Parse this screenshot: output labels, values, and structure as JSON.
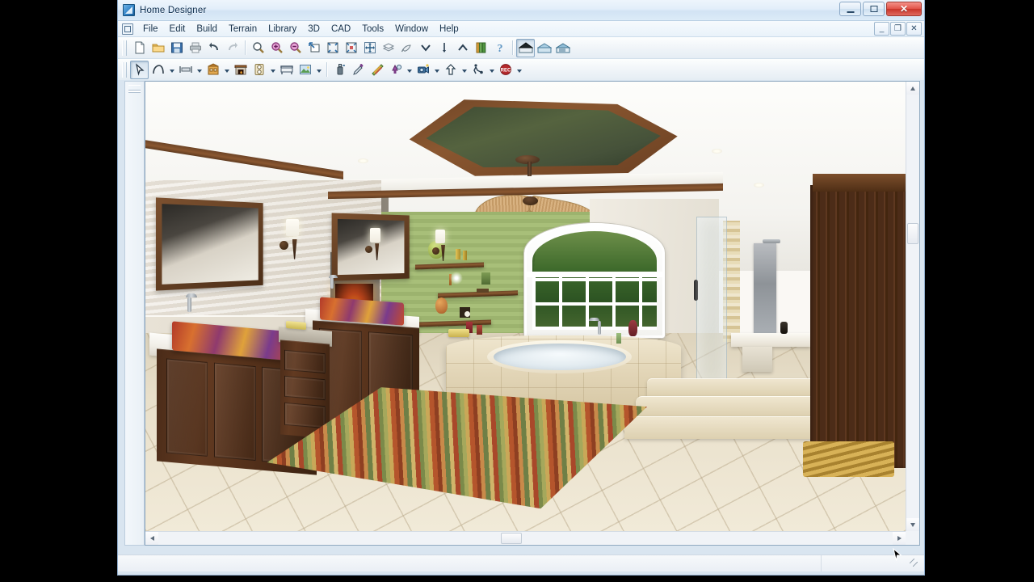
{
  "window": {
    "title": "Home Designer",
    "app_icon": "home-designer-logo-icon",
    "controls": {
      "minimize": "minimize-icon",
      "maximize": "maximize-icon",
      "close": "close-icon",
      "close_glyph": "✕"
    }
  },
  "mdi": {
    "icon": "document-window-icon",
    "controls": {
      "minimize": "_",
      "restore": "❐",
      "close": "✕"
    }
  },
  "menu": {
    "items": [
      {
        "label": "File"
      },
      {
        "label": "Edit"
      },
      {
        "label": "Build"
      },
      {
        "label": "Terrain"
      },
      {
        "label": "Library"
      },
      {
        "label": "3D"
      },
      {
        "label": "CAD"
      },
      {
        "label": "Tools"
      },
      {
        "label": "Window"
      },
      {
        "label": "Help"
      }
    ]
  },
  "toolbar_main": {
    "buttons": [
      {
        "name": "new-plan-button",
        "icon": "new-document-icon"
      },
      {
        "name": "open-plan-button",
        "icon": "open-folder-icon"
      },
      {
        "name": "save-plan-button",
        "icon": "floppy-save-icon"
      },
      {
        "name": "print-button",
        "icon": "printer-icon"
      },
      {
        "name": "undo-button",
        "icon": "undo-arrow-icon"
      },
      {
        "name": "redo-button",
        "icon": "redo-arrow-icon"
      },
      {
        "name": "zoom-button",
        "icon": "magnifier-icon"
      },
      {
        "name": "zoom-in-button",
        "icon": "magnifier-plus-icon"
      },
      {
        "name": "zoom-out-button",
        "icon": "magnifier-minus-icon"
      },
      {
        "name": "zoom-previous-button",
        "icon": "zoom-previous-icon"
      },
      {
        "name": "fill-window-button",
        "icon": "fill-window-icon"
      },
      {
        "name": "fill-window-selected-button",
        "icon": "fill-window-selected-icon"
      },
      {
        "name": "pan-button",
        "icon": "pan-move-icon"
      },
      {
        "name": "reference-display-button",
        "icon": "layers-icon"
      },
      {
        "name": "fill-color-button",
        "icon": "paint-hand-icon"
      },
      {
        "name": "down-one-floor-button",
        "icon": "chevron-down-icon"
      },
      {
        "name": "floor-reference-button",
        "icon": "vertical-bar-icon"
      },
      {
        "name": "up-one-floor-button",
        "icon": "chevron-up-icon"
      },
      {
        "name": "library-browser-button",
        "icon": "library-books-icon"
      },
      {
        "name": "help-button",
        "icon": "question-mark-icon"
      },
      {
        "name": "full-camera-button",
        "icon": "full-camera-house-icon",
        "active": true
      },
      {
        "name": "elevation-camera-button",
        "icon": "elevation-house-icon"
      },
      {
        "name": "overview-camera-button",
        "icon": "overview-house-icon"
      }
    ]
  },
  "toolbar_edit": {
    "buttons": [
      {
        "name": "select-objects-button",
        "icon": "select-arrow-icon",
        "active": true
      },
      {
        "name": "spline-button",
        "icon": "spline-curve-icon",
        "dropdown": true
      },
      {
        "name": "wall-tools-button",
        "icon": "wall-icon",
        "dropdown": true
      },
      {
        "name": "room-tools-button",
        "icon": "house-room-icon",
        "dropdown": true
      },
      {
        "name": "fireplace-button",
        "icon": "fireplace-icon"
      },
      {
        "name": "electrical-button",
        "icon": "outlet-icon",
        "dropdown": true
      },
      {
        "name": "furniture-button",
        "icon": "furniture-icon"
      },
      {
        "name": "pictures-button",
        "icon": "framed-picture-icon",
        "dropdown": true
      },
      {
        "name": "material-painter-button",
        "icon": "spray-can-icon"
      },
      {
        "name": "eyedropper-button",
        "icon": "eyedropper-icon"
      },
      {
        "name": "material-stripe-button",
        "icon": "material-swatch-icon"
      },
      {
        "name": "light-tools-button",
        "icon": "lamp-icon",
        "dropdown": true
      },
      {
        "name": "camera-tools-button",
        "icon": "camera-icon",
        "dropdown": true
      },
      {
        "name": "move-up-button",
        "icon": "up-arrow-icon",
        "dropdown": true
      },
      {
        "name": "walkthrough-button",
        "icon": "walkthrough-path-icon",
        "dropdown": true
      },
      {
        "name": "record-walkthrough-button",
        "icon": "record-rec-icon",
        "dropdown": true
      }
    ]
  },
  "left_dock": {
    "name": "library-side-panel",
    "grip": "panel-grip"
  },
  "scrollbars": {
    "vertical": {
      "up": "scroll-up-arrow",
      "down": "scroll-down-arrow",
      "thumb": "vertical-scroll-thumb"
    },
    "horizontal": {
      "left": "scroll-left-arrow",
      "right": "scroll-right-arrow",
      "thumb": "horizontal-scroll-thumb"
    }
  },
  "status_bar": {
    "text": ""
  },
  "scene": {
    "name": "3d-bathroom-render",
    "description": "Rendered 3D perspective view of a master bathroom",
    "colors": {
      "accent_green_wall": "#a8bf79",
      "wood_dark": "#4a2b18",
      "wood_trim": "#8a5730",
      "tile_floor": "#e9e0cb",
      "ceiling_inset": "#46523a",
      "counter_white": "#f1eee7"
    },
    "elements": [
      {
        "name": "tray-ceiling",
        "label": "Octagonal tray ceiling"
      },
      {
        "name": "ceiling-fan",
        "label": "Wicker blade ceiling fan"
      },
      {
        "name": "recessed-light",
        "label": "Recessed downlight"
      },
      {
        "name": "vanity-mirror",
        "label": "Framed vanity mirror"
      },
      {
        "name": "wall-sconce",
        "label": "Wall sconce"
      },
      {
        "name": "vessel-sink",
        "label": "Art glass vessel sink"
      },
      {
        "name": "vanity-cabinet",
        "label": "Dark wood vanity cabinet"
      },
      {
        "name": "soaking-tub",
        "label": "Tiled deck soaking tub"
      },
      {
        "name": "arched-window",
        "label": "Arched picture window"
      },
      {
        "name": "floating-shelf",
        "label": "Floating wood shelf"
      },
      {
        "name": "fireplace",
        "label": "Fireplace"
      },
      {
        "name": "area-rug",
        "label": "Striped area rug"
      },
      {
        "name": "shower-enclosure",
        "label": "Walk-in shower"
      },
      {
        "name": "tall-cabinet",
        "label": "Tall wood cabinet"
      },
      {
        "name": "tile-floor",
        "label": "Tile floor"
      }
    ]
  }
}
